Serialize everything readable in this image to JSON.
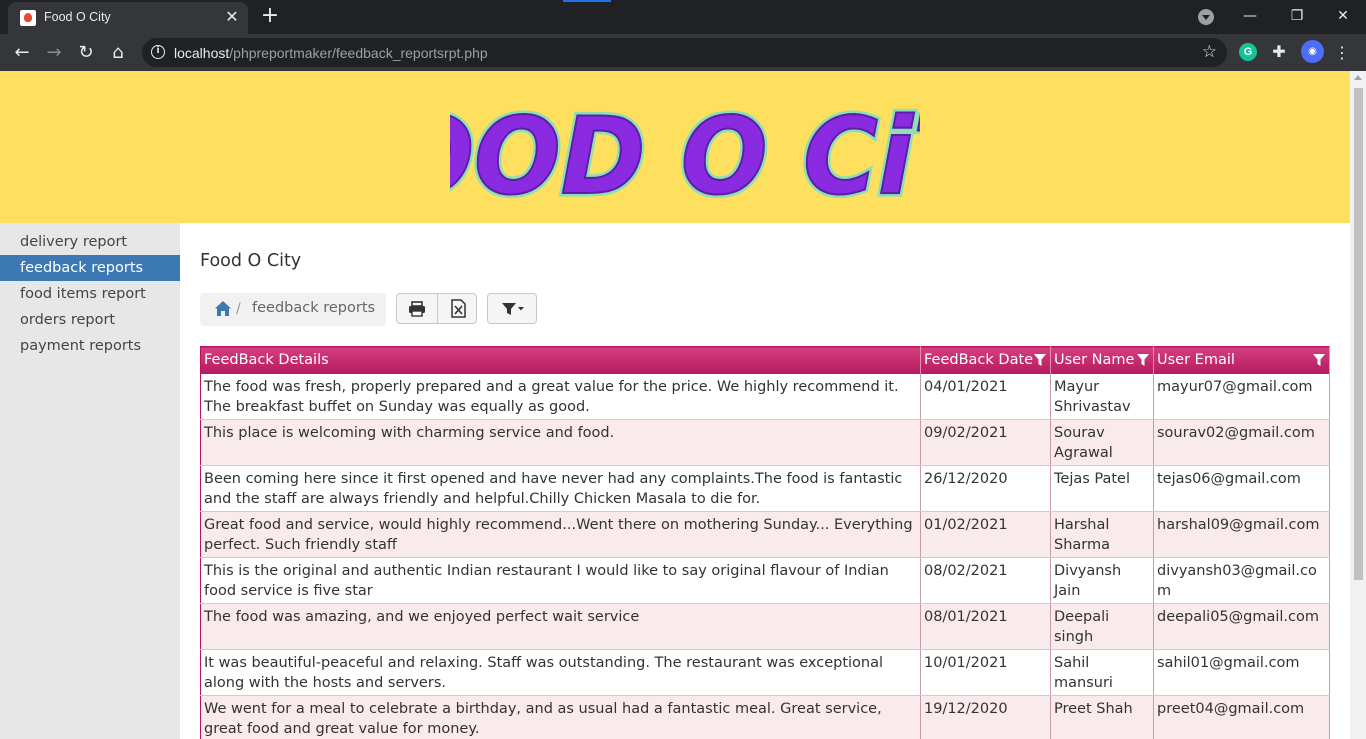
{
  "browser": {
    "tab_title": "Food O City",
    "tab_close": "✕",
    "new_tab": "+",
    "url_host": "localhost",
    "url_path": "/phpreportmaker/feedback_reportsrpt.php",
    "win_min": "—",
    "win_restore": "❐",
    "win_close": "✕"
  },
  "banner": {
    "logo_text": "FOOD O CiTY"
  },
  "sidebar": {
    "items": [
      {
        "label": "delivery report",
        "active": false
      },
      {
        "label": "feedback reports",
        "active": true
      },
      {
        "label": "food items report",
        "active": false
      },
      {
        "label": "orders report",
        "active": false
      },
      {
        "label": "payment reports",
        "active": false
      }
    ]
  },
  "main": {
    "title": "Food O City",
    "breadcrumb_sep": "/",
    "breadcrumb_current": "feedback reports"
  },
  "table": {
    "columns": [
      "FeedBack Details",
      "FeedBack Date",
      "User Name",
      "User Email"
    ],
    "rows": [
      [
        "The food was fresh, properly prepared and a great value for the price. We highly recommend it. The breakfast buffet on Sunday was equally as good.",
        "04/01/2021",
        "Mayur Shrivastav",
        "mayur07@gmail.com"
      ],
      [
        "This place is welcoming with charming service and food.",
        "09/02/2021",
        "Sourav Agrawal",
        "sourav02@gmail.com"
      ],
      [
        "Been coming here since it first opened and have never had any complaints.The food is fantastic and the staff are always friendly and helpful.Chilly Chicken Masala to die for.",
        "26/12/2020",
        "Tejas Patel",
        "tejas06@gmail.com"
      ],
      [
        "Great food and service, would highly recommend...Went there on mothering Sunday... Everything perfect. Such friendly staff",
        "01/02/2021",
        "Harshal Sharma",
        "harshal09@gmail.com"
      ],
      [
        "This is the original and authentic Indian restaurant I would like to say original flavour of Indian food service is five star",
        "08/02/2021",
        "Divyansh Jain",
        "divyansh03@gmail.com"
      ],
      [
        "The food was amazing, and we enjoyed perfect wait service",
        "08/01/2021",
        "Deepali singh",
        "deepali05@gmail.com"
      ],
      [
        "It was beautiful-peaceful and relaxing. Staff was outstanding. The restaurant was exceptional along with the hosts and servers.",
        "10/01/2021",
        "Sahil mansuri",
        "sahil01@gmail.com"
      ],
      [
        "We went for a meal to celebrate a birthday, and as usual had a fantastic meal. Great service, great food and great value for money.",
        "19/12/2020",
        "Preet Shah",
        "preet04@gmail.com"
      ]
    ]
  }
}
